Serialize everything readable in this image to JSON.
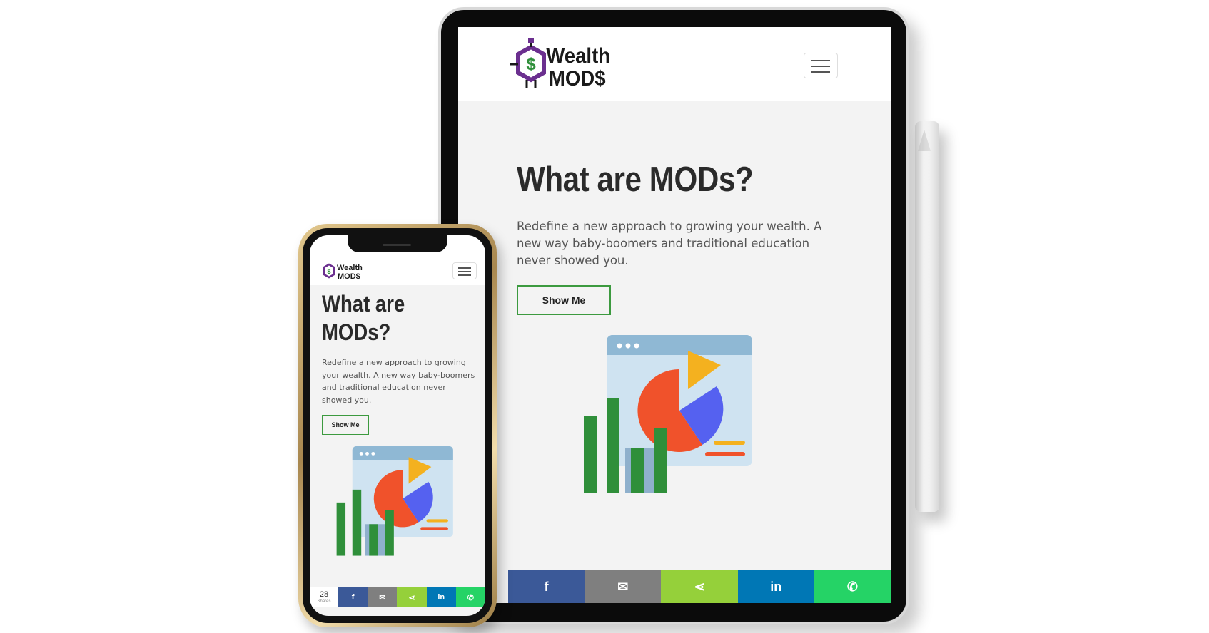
{
  "brand": {
    "line1": "Wealth",
    "line2": "MOD$",
    "symbol": "$",
    "colors": {
      "purple": "#6b2f8f",
      "green": "#2f8f3a",
      "text": "#1a1a1a"
    }
  },
  "hero": {
    "title": "What are MODs?",
    "title_phone_line1": "What are",
    "title_phone_line2": "MODs?",
    "subtitle": "Redefine a new approach to growing your wealth. A new way baby-boomers and traditional education never showed you.",
    "button_label": "Show Me"
  },
  "menu": {
    "icon": "hamburger-menu-icon"
  },
  "share_bar": {
    "count": "28",
    "count_label": "Shares",
    "buttons": [
      {
        "network": "facebook",
        "glyph": "f",
        "color": "#3b5998"
      },
      {
        "network": "email",
        "glyph": "✉",
        "color": "#7f7f7f"
      },
      {
        "network": "share",
        "glyph": "⋖",
        "color": "#95d03a"
      },
      {
        "network": "linkedin",
        "glyph": "in",
        "color": "#0077b5"
      },
      {
        "network": "whatsapp",
        "glyph": "✆",
        "color": "#25d366"
      }
    ]
  },
  "illustration": {
    "colors": {
      "window": "#cfe3f1",
      "window_bar": "#8fb8d4",
      "pie_red": "#f0522b",
      "pie_blue": "#5561f0",
      "pie_yellow": "#f4b11f",
      "bars": "#2f8f3a",
      "bars_bg": "#8fb0cc",
      "line_orange": "#f4b11f",
      "line_red": "#f0522b"
    }
  }
}
